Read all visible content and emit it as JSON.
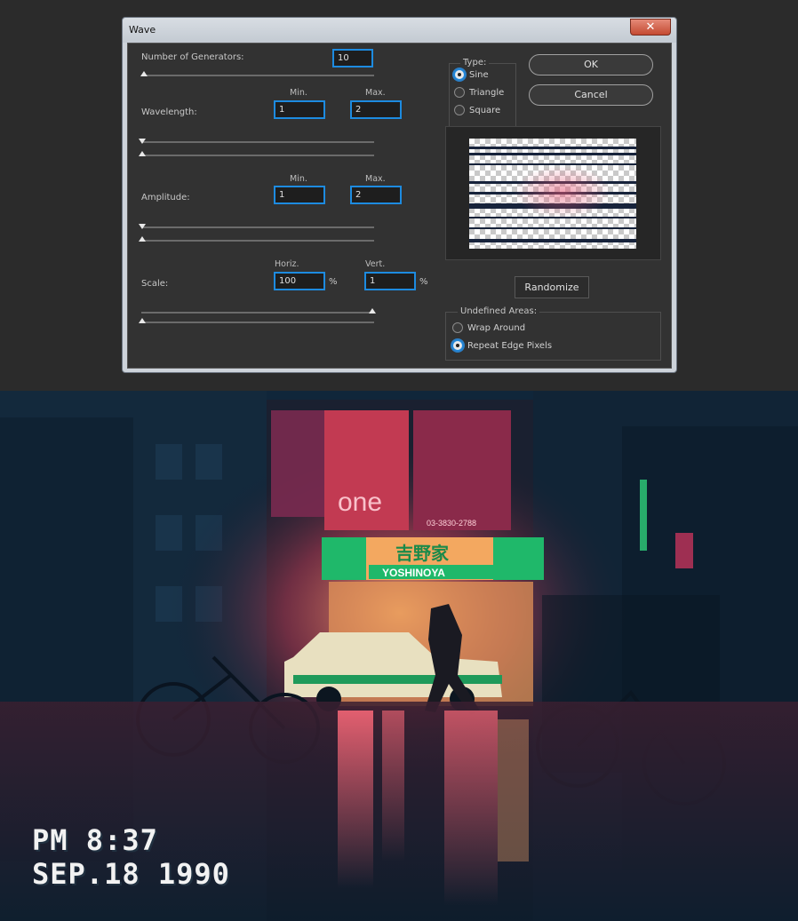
{
  "dialog": {
    "title": "Wave",
    "close_glyph": "✕",
    "generators": {
      "label": "Number of Generators:",
      "value": "10",
      "level": 0.0
    },
    "wavelength": {
      "label": "Wavelength:",
      "min_header": "Min.",
      "max_header": "Max.",
      "min": "1",
      "max": "2"
    },
    "amplitude": {
      "label": "Amplitude:",
      "min_header": "Min.",
      "max_header": "Max.",
      "min": "1",
      "max": "2"
    },
    "scale": {
      "label": "Scale:",
      "horiz_header": "Horiz.",
      "vert_header": "Vert.",
      "horiz": "100",
      "vert": "1",
      "unit": "%"
    },
    "type": {
      "legend": "Type:",
      "options": [
        {
          "label": "Sine",
          "checked": true
        },
        {
          "label": "Triangle",
          "checked": false
        },
        {
          "label": "Square",
          "checked": false
        }
      ]
    },
    "ok_label": "OK",
    "cancel_label": "Cancel",
    "randomize_label": "Randomize",
    "undefined_areas": {
      "legend": "Undefined Areas:",
      "options": [
        {
          "label": "Wrap Around",
          "checked": false
        },
        {
          "label": "Repeat Edge Pixels",
          "checked": true
        }
      ]
    }
  },
  "photo": {
    "vhs_time": "PM 8:37",
    "vhs_date": "SEP.18 1990",
    "sign_store": "吉野家",
    "sign_brand": "YOSHINOYA",
    "sign_one": "one",
    "sign_phone": "03-3830-2788"
  },
  "colors": {
    "accent": "#1d8be0",
    "dialog_bg": "#323232",
    "neon_green": "#1fb86a",
    "neon_pink": "#ff2a6d"
  }
}
